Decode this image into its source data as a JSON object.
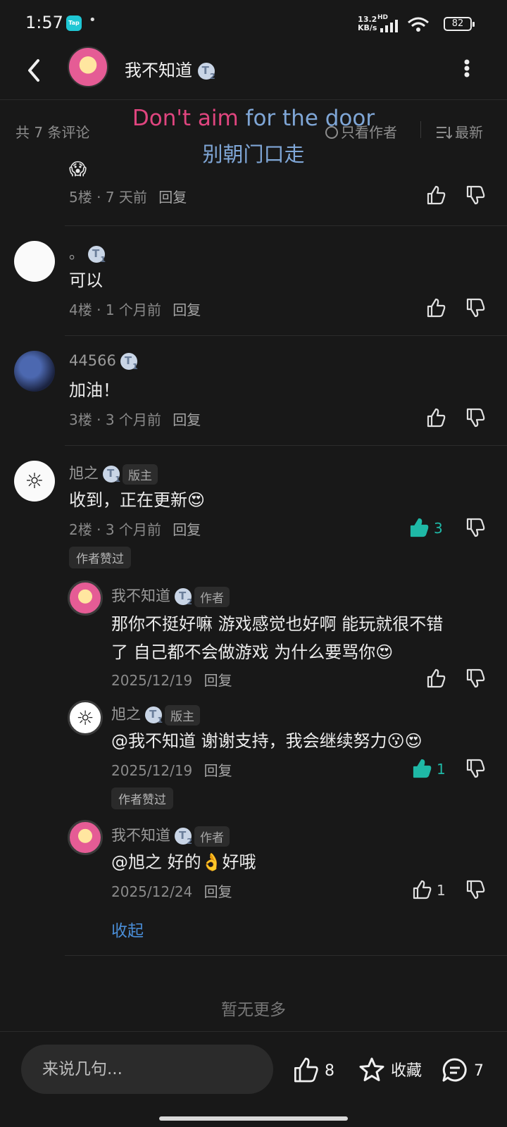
{
  "status_bar": {
    "time": "1:57",
    "app_badge": "Tap",
    "dot": "•",
    "speed_value": "13.2",
    "speed_unit": "KB/s",
    "network": "HD",
    "battery": "82"
  },
  "header": {
    "title": "我不知道",
    "level": "2"
  },
  "sort_bar": {
    "count_label": "共 7 条评论",
    "author_only_label": "只看作者",
    "sort_label": "最新"
  },
  "subtitle": {
    "line1_part1": "Don't aim",
    "line1_part2": "for the door",
    "line2": "别朝门口走"
  },
  "partial_comment": {
    "emoji": "😱",
    "floor": "5楼",
    "time": "7 天前",
    "reply_label": "回复"
  },
  "comments": [
    {
      "name": "。",
      "level": "1",
      "text": "可以",
      "floor": "4楼",
      "time": "1 个月前",
      "reply_label": "回复"
    },
    {
      "name": "44566",
      "level": "1",
      "text": "加油！",
      "floor": "3楼",
      "time": "3 个月前",
      "reply_label": "回复"
    },
    {
      "name": "旭之",
      "level": "1",
      "tag": "版主",
      "text": "收到，正在更新😍",
      "floor": "2楼",
      "time": "3 个月前",
      "reply_label": "回复",
      "likes": "3",
      "author_liked": "作者赞过",
      "replies": [
        {
          "name": "我不知道",
          "level": "2",
          "tag": "作者",
          "text_line1": "那你不挺好嘛 游戏感觉也好啊 能玩就很不错",
          "text_line2": "了 自己都不会做游戏 为什么要骂你😍",
          "date": "2025/12/19",
          "reply_label": "回复"
        },
        {
          "name": "旭之",
          "level": "1",
          "tag": "版主",
          "text": "@我不知道  谢谢支持，我会继续努力😗😍",
          "date": "2025/12/19",
          "reply_label": "回复",
          "likes": "1",
          "author_liked": "作者赞过"
        },
        {
          "name": "我不知道",
          "level": "2",
          "tag": "作者",
          "text": "@旭之  好的👌好哦",
          "date": "2025/12/24",
          "reply_label": "回复",
          "likes": "1"
        }
      ],
      "collapse_label": "收起"
    }
  ],
  "no_more_label": "暂无更多",
  "bottom_bar": {
    "input_placeholder": "来说几句...",
    "like_count": "8",
    "favorite_label": "收藏",
    "comment_count": "7"
  },
  "colors": {
    "background": "#181818",
    "accent_teal": "#1fb8a6",
    "link_blue": "#4a8ed8",
    "subtitle_pink": "#e0457f",
    "subtitle_blue": "#7fa6d6"
  }
}
